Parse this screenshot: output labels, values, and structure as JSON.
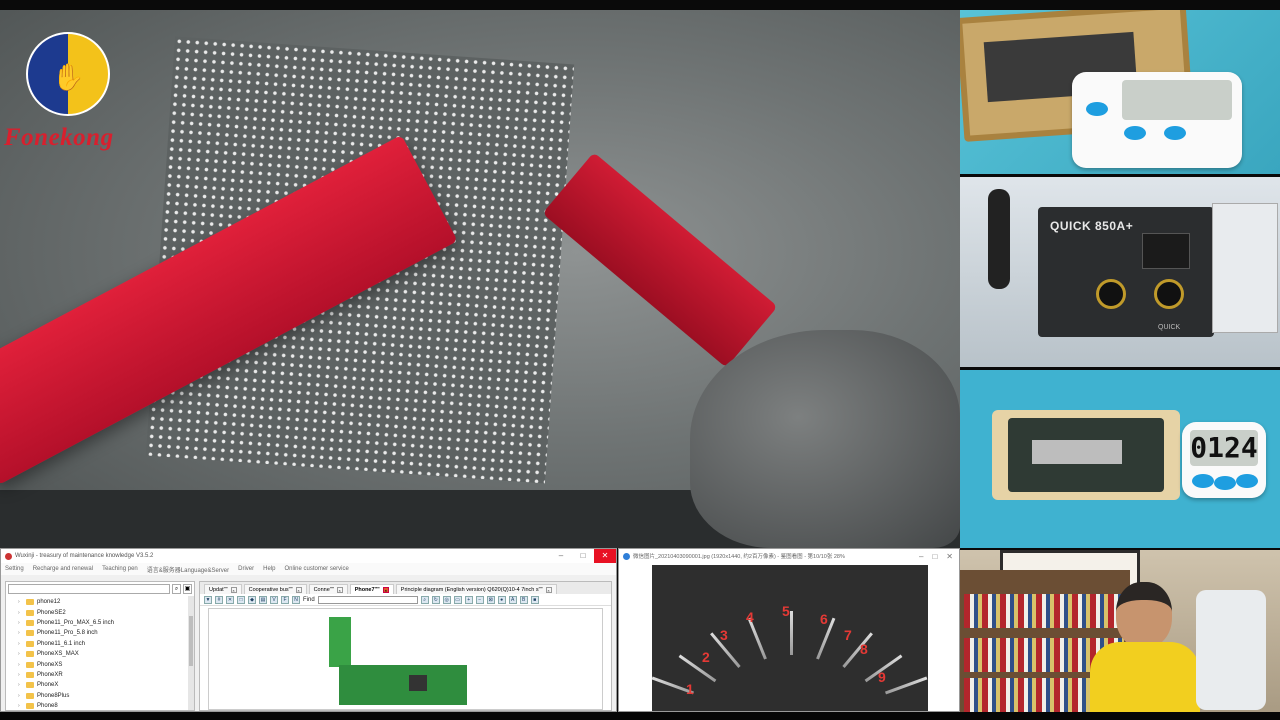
{
  "logo": {
    "brand": "Fonekong"
  },
  "cameras": {
    "hot_plate_timer": {
      "display": ""
    },
    "rework_station": {
      "brand": "QUICK 850A+",
      "bottom_label": "QUICK"
    },
    "fixture_timer": {
      "display": "0124"
    }
  },
  "software": {
    "title": "Wuxinji - treasury of maintenance knowledge V3.5.2",
    "menu": [
      "Setting",
      "Recharge and renewal",
      "Teaching pen",
      "语言&服务器Language&Server",
      "Driver",
      "Help",
      "Online customer service"
    ],
    "tree": [
      "phone12",
      "PhoneSE2",
      "Phone11_Pro_MAX_6.5 inch",
      "Phone11_Pro_5.8 inch",
      "Phone11_6.1 inch",
      "PhoneXS_MAX",
      "PhoneXS",
      "PhoneXR",
      "PhoneX",
      "Phone8Plus",
      "Phone8"
    ],
    "tabs": [
      "Updat\"\"",
      "Cooperative bus\"\"",
      "Conne\"\"",
      "Phone7\"\"",
      "Principle diagram (English version) Q620(Q)10-4 7inch s\"\""
    ],
    "active_tab_index": 3,
    "find_label": "Find"
  },
  "viewer": {
    "title": "微信图片_20210403090001.jpg (1920x1440, 约2百万像素) - 鉴图看图 - 第10/10张 28%",
    "numbers": [
      "1",
      "2",
      "3",
      "4",
      "5",
      "6",
      "7",
      "8",
      "9"
    ]
  }
}
